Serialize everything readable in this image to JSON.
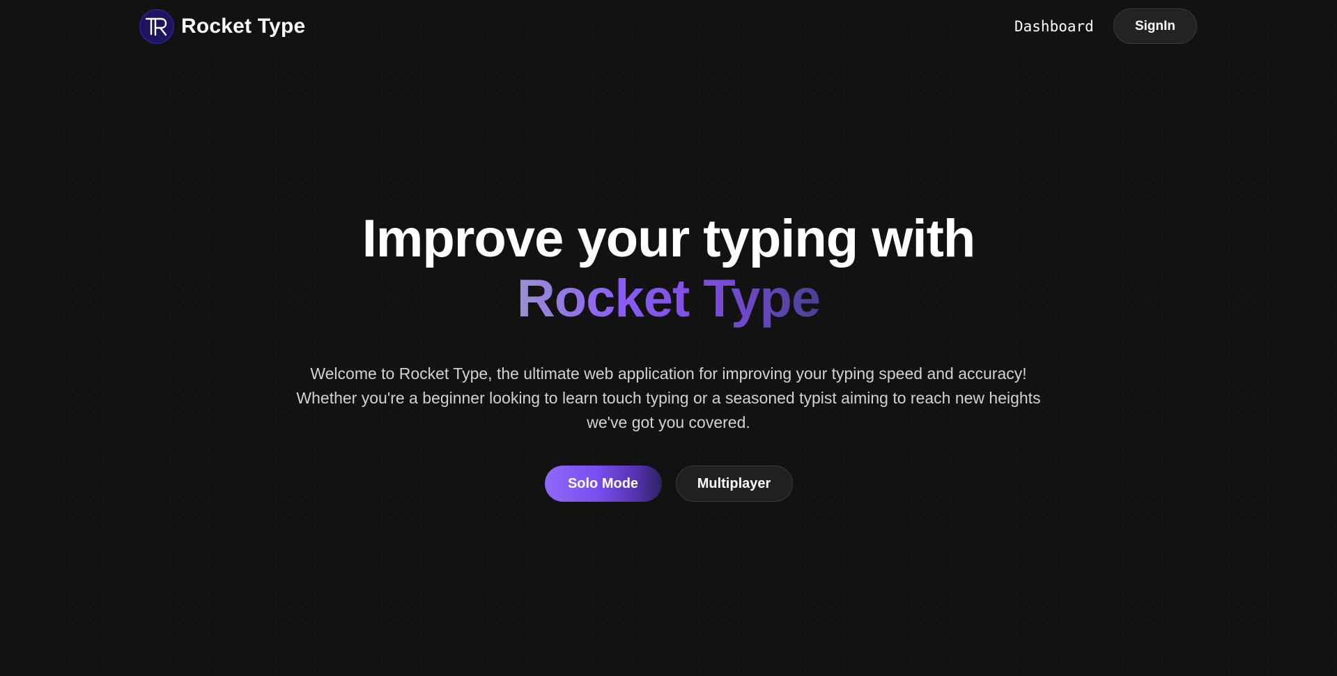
{
  "navbar": {
    "brand_name": "Rocket Type",
    "logo_letters": "TR",
    "dashboard_label": "Dashboard",
    "signin_label": "SignIn"
  },
  "hero": {
    "title_line1": "Improve your typing with",
    "title_line2": "Rocket Type",
    "description_line1": "Welcome to Rocket Type, the ultimate web application for improving your typing speed and accuracy!",
    "description_line2": "Whether you're a beginner looking to learn touch typing or a seasoned typist aiming to reach new heights",
    "description_line3": "we've got you covered.",
    "solo_button_label": "Solo Mode",
    "multiplayer_button_label": "Multiplayer"
  },
  "colors": {
    "background": "#121212",
    "accent": "#8b5cf6",
    "logo_background": "#1d1460",
    "text_primary": "#ffffff",
    "text_secondary": "#d2d2d2"
  },
  "icons": {
    "logo": "rocket-type-logo-icon"
  }
}
